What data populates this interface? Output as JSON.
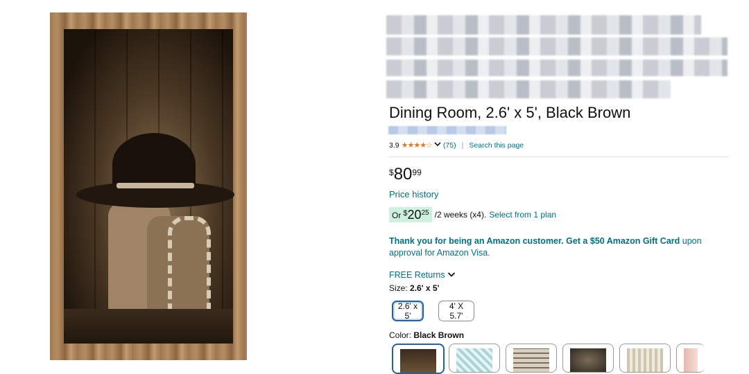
{
  "product": {
    "title": "Dining Room, 2.6' x 5', Black Brown",
    "rating": {
      "value": "3.9",
      "stars": "★★★★☆",
      "count": "(75)",
      "search_link": "Search this page"
    },
    "price": {
      "symbol": "$",
      "whole": "80",
      "fraction": "99"
    },
    "price_history": "Price history",
    "installment": {
      "prefix": "Or",
      "symbol": "$",
      "whole": "20",
      "fraction": "25",
      "term": "/2 weeks (x4).",
      "plan_link": "Select from 1 plan"
    },
    "offer": {
      "bold": "Thank you for being an Amazon customer. Get a $50 Amazon Gift Card",
      "rest": " upon approval for Amazon Visa."
    },
    "returns": "FREE Returns",
    "size": {
      "label": "Size:",
      "selected": "2.6' x 5'",
      "options": [
        "2.6' x 5'",
        "4' X 5.7'"
      ]
    },
    "color": {
      "label": "Color:",
      "selected": "Black Brown"
    }
  },
  "colors": {
    "link": "#007185",
    "star": "#de7921",
    "selected_border": "#2162a1",
    "installment_bg": "#cff1e0"
  },
  "icons": {
    "chevron": "chevron-down-icon"
  }
}
